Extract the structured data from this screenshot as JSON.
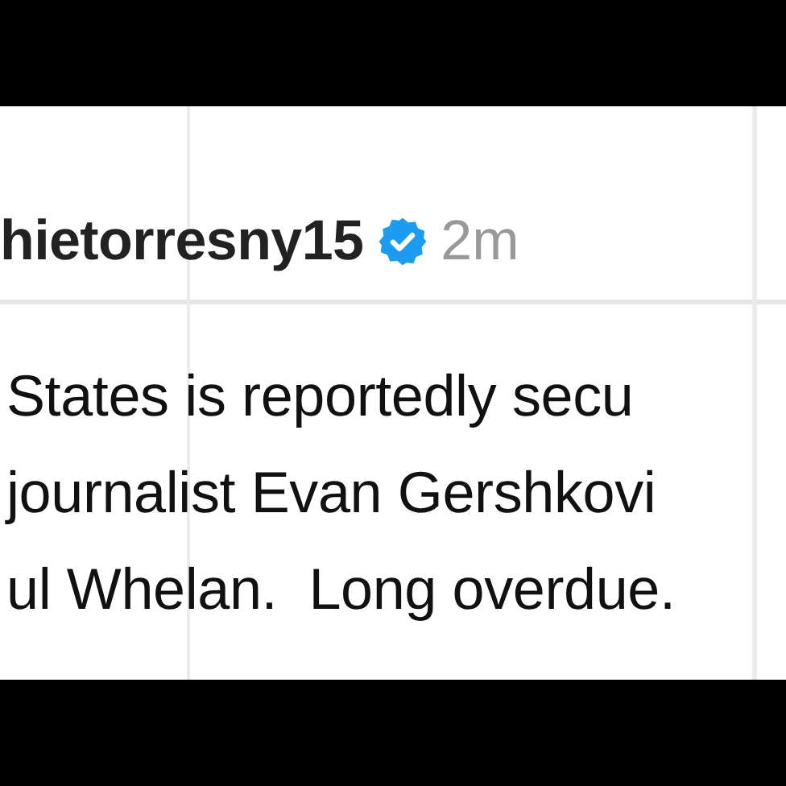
{
  "post": {
    "username": "hietorresny15",
    "verified": true,
    "time": "2m",
    "lines": [
      "States is reportedly secu",
      "journalist Evan Gershkovi",
      "ul Whelan.  Long overdue."
    ]
  }
}
